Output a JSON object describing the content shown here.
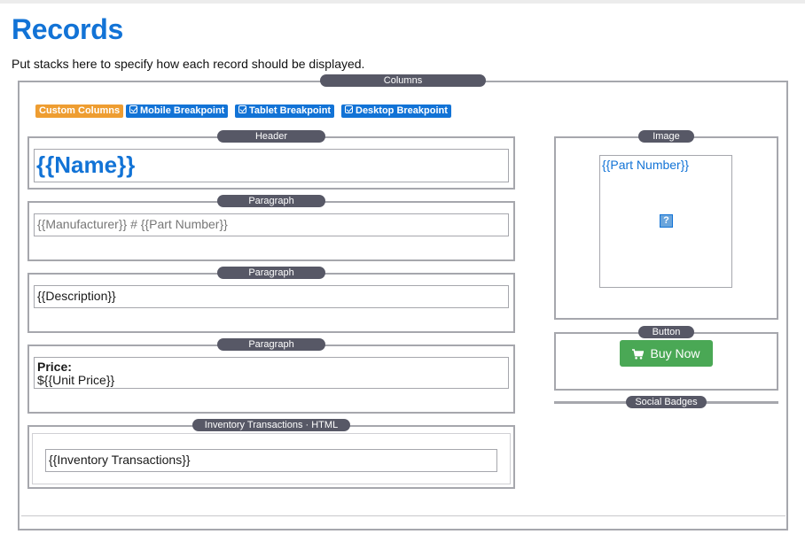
{
  "page": {
    "title": "Records",
    "description": "Put stacks here to specify how each record should be displayed."
  },
  "columns": {
    "label": "Columns",
    "badges": {
      "custom": "Custom Columns",
      "mobile": "Mobile Breakpoint",
      "tablet": "Tablet Breakpoint",
      "desktop": "Desktop Breakpoint"
    }
  },
  "left": {
    "header": {
      "label": "Header",
      "value": "{{Name}}"
    },
    "paragraph1": {
      "label": "Paragraph",
      "value": "{{Manufacturer}} # {{Part Number}}"
    },
    "paragraph2": {
      "label": "Paragraph",
      "value": "{{Description}}"
    },
    "paragraph3": {
      "label": "Paragraph",
      "price_label": "Price:",
      "price_value": "${{Unit Price}}"
    },
    "html": {
      "label": "Inventory Transactions · HTML",
      "value": "{{Inventory Transactions}}"
    }
  },
  "right": {
    "image": {
      "label": "Image",
      "caption": "{{Part Number}}",
      "placeholder": "?"
    },
    "button": {
      "label": "Button",
      "text": "Buy Now"
    },
    "social": {
      "label": "Social Badges"
    }
  },
  "colors": {
    "accent": "#1273d6",
    "custom_badge": "#ee9d31",
    "buy_button": "#4aa855",
    "pill": "#575866",
    "border": "#a6a7ad"
  },
  "icons": [
    "checkbox-icon",
    "cart-icon",
    "broken-image-icon"
  ]
}
